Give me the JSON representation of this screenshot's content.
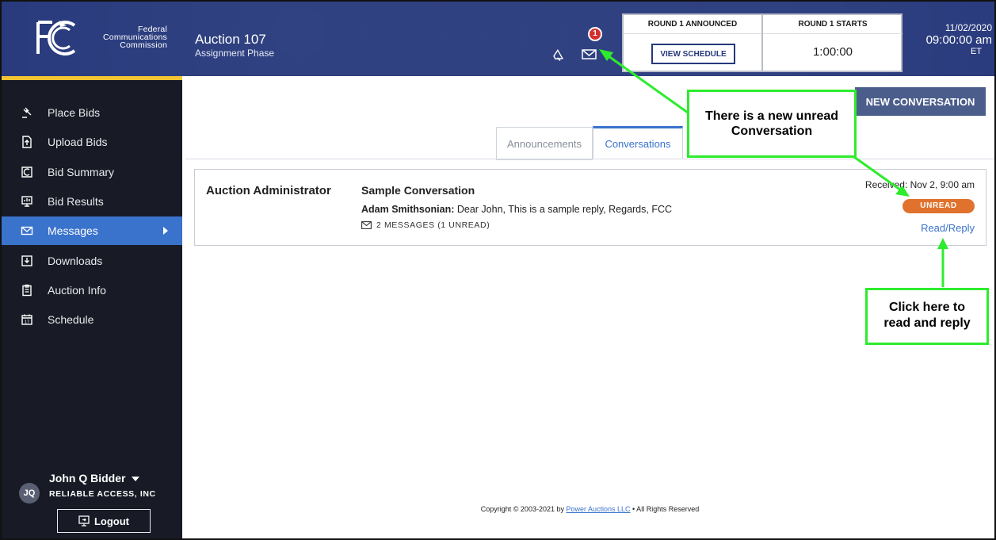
{
  "header": {
    "agency_lines": [
      "Federal",
      "Communications",
      "Commission"
    ],
    "auction_title": "Auction 107",
    "auction_phase": "Assignment Phase",
    "mail_badge_count": "1",
    "round_announced_label": "ROUND 1 ANNOUNCED",
    "view_schedule_label": "VIEW SCHEDULE",
    "round_starts_label": "ROUND 1 STARTS",
    "round_starts_time": "1:00:00",
    "date": "11/02/2020",
    "time": "09:00:00 am",
    "timezone": "ET"
  },
  "sidebar": {
    "items": [
      {
        "label": "Place Bids",
        "icon": "gavel-icon"
      },
      {
        "label": "Upload Bids",
        "icon": "upload-file-icon"
      },
      {
        "label": "Bid Summary",
        "icon": "chart-icon"
      },
      {
        "label": "Bid Results",
        "icon": "results-icon"
      },
      {
        "label": "Messages",
        "icon": "envelope-icon",
        "active": true
      },
      {
        "label": "Downloads",
        "icon": "download-icon"
      },
      {
        "label": "Auction Info",
        "icon": "clipboard-icon"
      },
      {
        "label": "Schedule",
        "icon": "calendar-icon"
      }
    ],
    "user": {
      "initials": "JQ",
      "name": "John Q Bidder",
      "org": "RELIABLE ACCESS, INC"
    },
    "logout_label": "Logout"
  },
  "main": {
    "new_conversation_label": "NEW CONVERSATION",
    "tabs": [
      {
        "label": "Announcements",
        "active": false
      },
      {
        "label": "Conversations",
        "active": true
      }
    ],
    "conversation": {
      "sender": "Auction Administrator",
      "subject": "Sample Conversation",
      "preview_author": "Adam Smithsonian:",
      "preview_text": " Dear John, This is a sample reply, Regards, FCC",
      "message_count": "2 MESSAGES (1 UNREAD)",
      "received": "Received: Nov 2, 9:00 am",
      "status": "UNREAD",
      "action_label": "Read/Reply"
    },
    "footer": {
      "prefix": "Copyright © 2003-2021 by ",
      "link": "Power Auctions LLC",
      "suffix": " • All Rights Reserved"
    }
  },
  "annotations": {
    "callout_unread": [
      "There is a new unread",
      "Conversation"
    ],
    "callout_reply": [
      "Click here to",
      "read and reply"
    ],
    "color": "#2dec2d"
  },
  "colors": {
    "header_bg": "#26387b",
    "sidebar_bg": "#181b25",
    "accent_yellow": "#f4c430",
    "active_blue": "#3a73cc",
    "unread_orange": "#e0722d"
  }
}
